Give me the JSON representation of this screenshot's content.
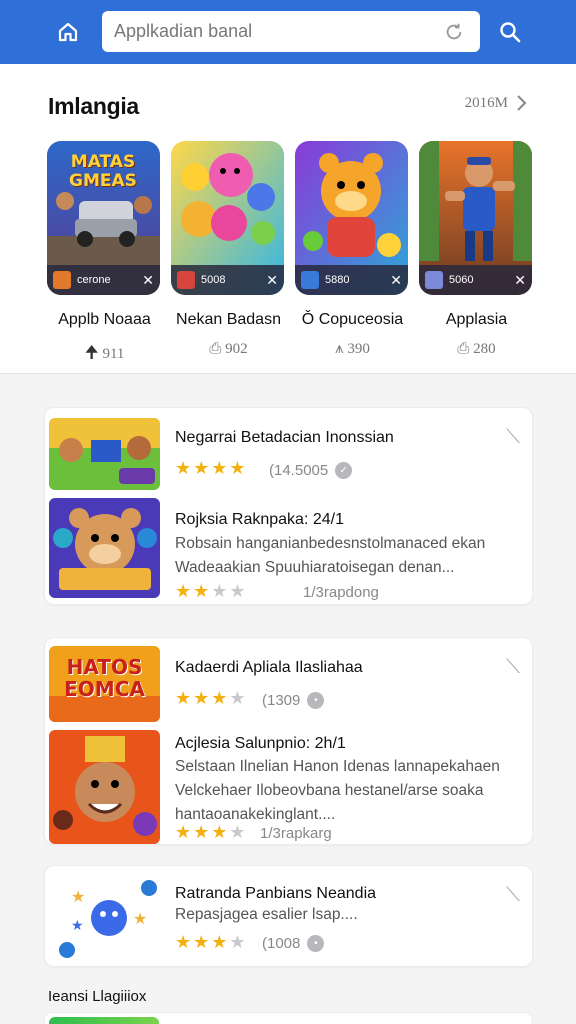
{
  "header": {
    "search_placeholder": "Applkadian banal",
    "icons": {
      "home": "home-icon",
      "refresh": "refresh-icon",
      "search": "search-icon"
    },
    "bg_color": "#2f6fd8"
  },
  "featured": {
    "title": "Imlangia",
    "see_all_label": "2016M",
    "tiles": [
      {
        "name": "Applb Noaaa",
        "count": "911",
        "count_icon": "arrow-up-icon",
        "art_text": "MATAS GMEAS",
        "strip_label": "cerone"
      },
      {
        "name": "Nekan Badasn",
        "count": "902",
        "count_icon": "download-icon",
        "strip_label": "5008"
      },
      {
        "name": "Ǒ Copuceosia",
        "count": "390",
        "count_icon": "person-icon",
        "strip_label": "5880"
      },
      {
        "name": "Applasia",
        "count": "280",
        "count_icon": "download-icon",
        "strip_label": "5060"
      }
    ]
  },
  "cards": [
    {
      "rows": [
        {
          "title": "Negarrai Betadacian Inonssian",
          "rating": 4,
          "count": "(14.5005"
        },
        {
          "title": "Rojksia Raknpaka: 24/1",
          "desc": "Robsain hanganianbedesnstolmanaced ekan Wadeaakian Spuuhiaratoisegan denan...",
          "rating": 2,
          "count": "1/3rapdong"
        }
      ]
    },
    {
      "rows": [
        {
          "title": "Kadaerdi Apliala Ilasliahaa",
          "rating": 3,
          "count": "(1309",
          "art_text": "HATOS EOMCA"
        },
        {
          "title": "Acjlesia Salunpnio: 2h/1",
          "desc": "Selstaan Ilnelian Hanon Idenas lannapekahaen Velckehaer Ilobeovbana hestanel/arse soaka hantaoanakekinglant....",
          "rating": 3,
          "count": "1/3rapkarg"
        }
      ]
    },
    {
      "rows": [
        {
          "title": "Ratranda Panbians Neandia",
          "desc": "Repasjagea esalier lsap....",
          "rating": 3,
          "count": "(1008"
        }
      ]
    }
  ],
  "bottom": {
    "title": "Ieansi Llagiiiox"
  },
  "colors": {
    "star": "#f2b10f",
    "star_off": "#c9c9cc"
  }
}
